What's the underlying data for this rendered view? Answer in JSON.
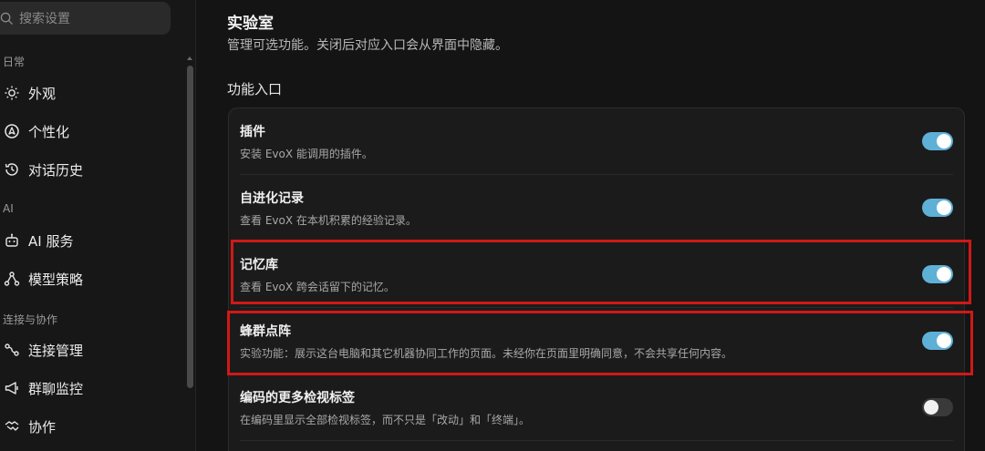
{
  "sidebar": {
    "search_placeholder": "搜索设置",
    "sections": [
      {
        "label": "日常"
      },
      {
        "label": "AI"
      },
      {
        "label": "连接与协作"
      }
    ],
    "items": [
      {
        "label": "外观",
        "icon": "sun-icon"
      },
      {
        "label": "个性化",
        "icon": "compass-icon"
      },
      {
        "label": "对话历史",
        "icon": "history-icon"
      },
      {
        "label": "AI 服务",
        "icon": "bot-icon"
      },
      {
        "label": "模型策略",
        "icon": "network-icon"
      },
      {
        "label": "连接管理",
        "icon": "connection-icon"
      },
      {
        "label": "群聊监控",
        "icon": "megaphone-icon"
      },
      {
        "label": "协作",
        "icon": "handshake-icon"
      }
    ]
  },
  "main": {
    "title": "实验室",
    "subtitle": "管理可选功能。关闭后对应入口会从界面中隐藏。",
    "group_title": "功能入口",
    "features": [
      {
        "title": "插件",
        "desc": "安装 EvoX 能调用的插件。",
        "enabled": true
      },
      {
        "title": "自进化记录",
        "desc": "查看 EvoX 在本机积累的经验记录。",
        "enabled": true
      },
      {
        "title": "记忆库",
        "desc": "查看 EvoX 跨会话留下的记忆。",
        "enabled": true
      },
      {
        "title": "蜂群点阵",
        "desc": "实验功能：展示这台电脑和其它机器协同工作的页面。未经你在页面里明确同意，不会共享任何内容。",
        "enabled": true
      },
      {
        "title": "编码的更多检视标签",
        "desc": "在编码里显示全部检视标签，而不只是「改动」和「终端」。",
        "enabled": false
      }
    ]
  },
  "colors": {
    "toggle_on": "#5fb0d6",
    "toggle_off": "#3a3a3a",
    "highlight": "#d01818"
  }
}
